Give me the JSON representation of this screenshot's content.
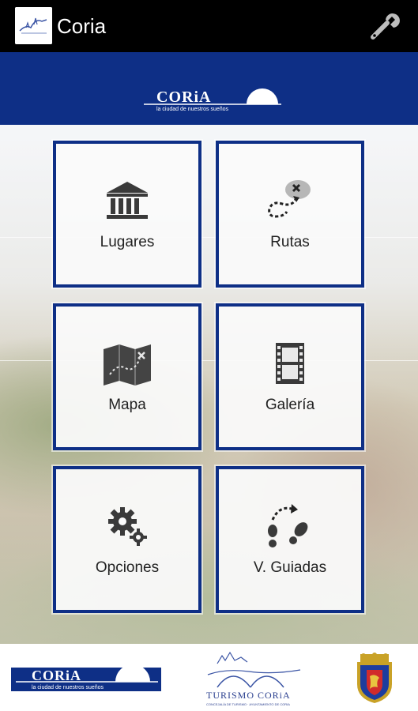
{
  "app": {
    "title": "Coria",
    "settings_icon": "wrench-icon"
  },
  "banner": {
    "logo_text": "CORiA",
    "tagline": "la ciudad de nuestros sueños"
  },
  "menu": [
    {
      "label": "Lugares",
      "icon": "bank-icon"
    },
    {
      "label": "Rutas",
      "icon": "route-map-icon"
    },
    {
      "label": "Mapa",
      "icon": "folded-map-icon"
    },
    {
      "label": "Galería",
      "icon": "film-strip-icon"
    },
    {
      "label": "Opciones",
      "icon": "gears-icon"
    },
    {
      "label": "V. Guiadas",
      "icon": "footprints-icon"
    }
  ],
  "footer": {
    "coria_logo_text": "CORiA",
    "coria_tagline": "la ciudad de nuestros sueños",
    "turismo_title": "TURISMO CORiA",
    "turismo_subtitle": "CONCEJALÍA DE TURISMO · AYUNTAMIENTO DE CORIA"
  },
  "colors": {
    "appbar": "#000000",
    "brand_blue": "#0e2f86",
    "tile_bg": "#fafafa",
    "label": "#222222"
  }
}
